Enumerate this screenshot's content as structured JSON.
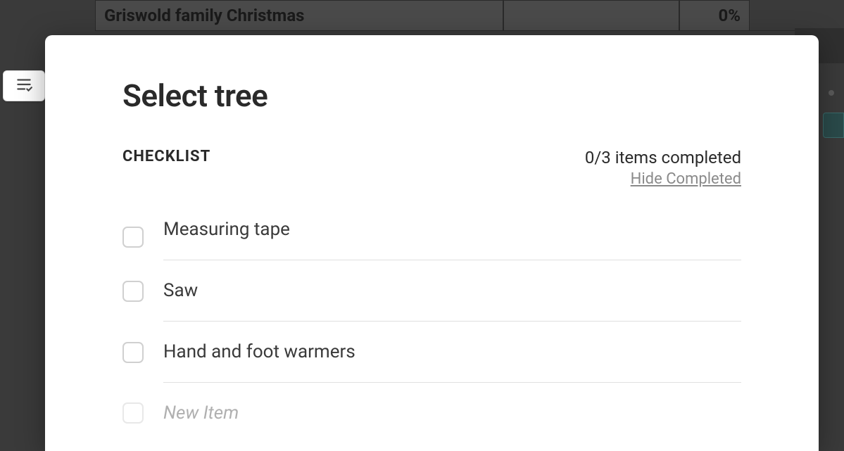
{
  "background": {
    "row_title": "Griswold family Christmas",
    "row_percent": "0%"
  },
  "modal": {
    "title": "Select tree",
    "checklist_label": "CHECKLIST",
    "items_completed": "0/3 items completed",
    "hide_completed": "Hide Completed",
    "items": [
      {
        "text": "Measuring tape"
      },
      {
        "text": "Saw"
      },
      {
        "text": "Hand and foot warmers"
      }
    ],
    "new_item_placeholder": "New Item"
  }
}
